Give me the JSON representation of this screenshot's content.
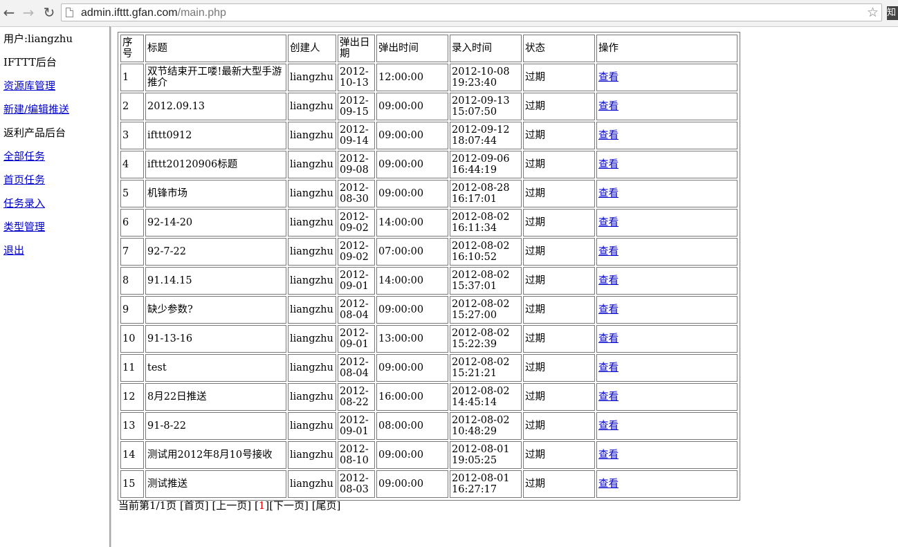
{
  "browser": {
    "url_host": "admin.ifttt.gfan.com",
    "url_path": "/main.php",
    "ext_label": "知"
  },
  "menu": {
    "user": "用户:liangzhu",
    "items": [
      {
        "label": "IFTTT后台",
        "link": false
      },
      {
        "label": "资源库管理",
        "link": true
      },
      {
        "label": "新建/编辑推送",
        "link": true
      },
      {
        "label": "返利产品后台",
        "link": false
      },
      {
        "label": "全部任务",
        "link": true
      },
      {
        "label": "首页任务",
        "link": true
      },
      {
        "label": "任务录入",
        "link": true
      },
      {
        "label": "类型管理",
        "link": true
      },
      {
        "label": "退出",
        "link": true
      }
    ]
  },
  "table": {
    "headers": [
      "序号",
      "标题",
      "创建人",
      "弹出日期",
      "弹出时间",
      "录入时间",
      "状态",
      "操作"
    ],
    "rows": [
      {
        "id": "1",
        "title": "双节结束开工喽!最新大型手游推介",
        "creator": "liangzhu",
        "date": "2012-10-13",
        "time": "12:00:00",
        "entered": "2012-10-08 19:23:40",
        "status": "过期",
        "action": "查看"
      },
      {
        "id": "2",
        "title": "2012.09.13",
        "creator": "liangzhu",
        "date": "2012-09-15",
        "time": "09:00:00",
        "entered": "2012-09-13 15:07:50",
        "status": "过期",
        "action": "查看"
      },
      {
        "id": "3",
        "title": "ifttt0912",
        "creator": "liangzhu",
        "date": "2012-09-14",
        "time": "09:00:00",
        "entered": "2012-09-12 18:07:44",
        "status": "过期",
        "action": "查看"
      },
      {
        "id": "4",
        "title": "ifttt20120906标题",
        "creator": "liangzhu",
        "date": "2012-09-08",
        "time": "09:00:00",
        "entered": "2012-09-06 16:44:19",
        "status": "过期",
        "action": "查看"
      },
      {
        "id": "5",
        "title": "机锋市场",
        "creator": "liangzhu",
        "date": "2012-08-30",
        "time": "09:00:00",
        "entered": "2012-08-28 16:17:01",
        "status": "过期",
        "action": "查看"
      },
      {
        "id": "6",
        "title": "92-14-20",
        "creator": "liangzhu",
        "date": "2012-09-02",
        "time": "14:00:00",
        "entered": "2012-08-02 16:11:34",
        "status": "过期",
        "action": "查看"
      },
      {
        "id": "7",
        "title": "92-7-22",
        "creator": "liangzhu",
        "date": "2012-09-02",
        "time": "07:00:00",
        "entered": "2012-08-02 16:10:52",
        "status": "过期",
        "action": "查看"
      },
      {
        "id": "8",
        "title": "91.14.15",
        "creator": "liangzhu",
        "date": "2012-09-01",
        "time": "14:00:00",
        "entered": "2012-08-02 15:37:01",
        "status": "过期",
        "action": "查看"
      },
      {
        "id": "9",
        "title": "缺少参数?",
        "creator": "liangzhu",
        "date": "2012-08-04",
        "time": "09:00:00",
        "entered": "2012-08-02 15:27:00",
        "status": "过期",
        "action": "查看"
      },
      {
        "id": "10",
        "title": "91-13-16",
        "creator": "liangzhu",
        "date": "2012-09-01",
        "time": "13:00:00",
        "entered": "2012-08-02 15:22:39",
        "status": "过期",
        "action": "查看"
      },
      {
        "id": "11",
        "title": "test",
        "creator": "liangzhu",
        "date": "2012-08-04",
        "time": "09:00:00",
        "entered": "2012-08-02 15:21:21",
        "status": "过期",
        "action": "查看"
      },
      {
        "id": "12",
        "title": "8月22日推送",
        "creator": "liangzhu",
        "date": "2012-08-22",
        "time": "16:00:00",
        "entered": "2012-08-02 14:45:14",
        "status": "过期",
        "action": "查看"
      },
      {
        "id": "13",
        "title": "91-8-22",
        "creator": "liangzhu",
        "date": "2012-09-01",
        "time": "08:00:00",
        "entered": "2012-08-02 10:48:29",
        "status": "过期",
        "action": "查看"
      },
      {
        "id": "14",
        "title": "测试用2012年8月10号接收",
        "creator": "liangzhu",
        "date": "2012-08-10",
        "time": "09:00:00",
        "entered": "2012-08-01 19:05:25",
        "status": "过期",
        "action": "查看"
      },
      {
        "id": "15",
        "title": "测试推送",
        "creator": "liangzhu",
        "date": "2012-08-03",
        "time": "09:00:00",
        "entered": "2012-08-01 16:27:17",
        "status": "过期",
        "action": "查看"
      }
    ]
  },
  "pager": {
    "summary": "当前第1/1页",
    "first": "[首页]",
    "prev": "[上一页]",
    "open_bracket": "[",
    "current": "1",
    "close_bracket": "]",
    "next": "[下一页]",
    "last": "[尾页]"
  }
}
